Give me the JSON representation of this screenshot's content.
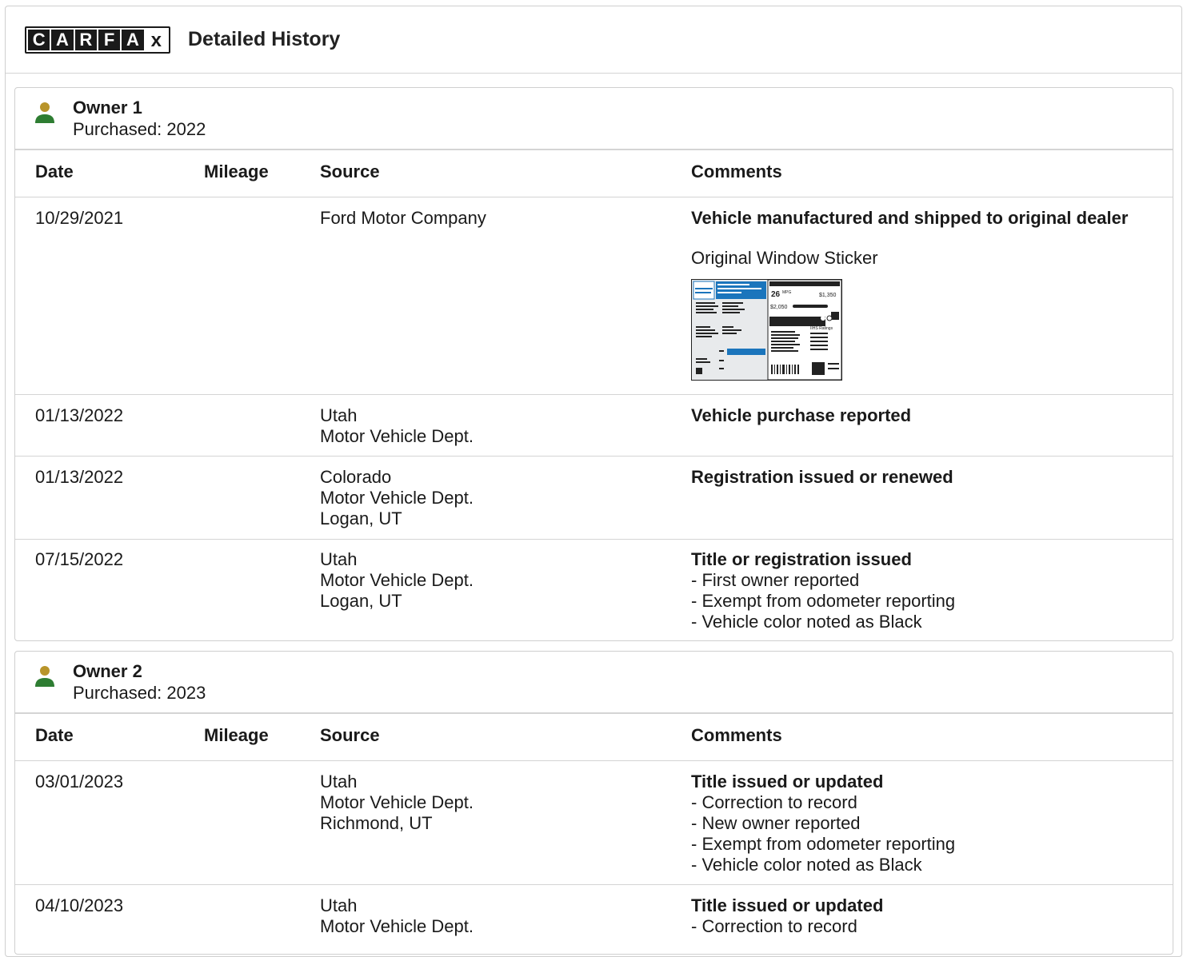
{
  "header": {
    "logo_letters": [
      "C",
      "A",
      "R",
      "F",
      "A",
      "x"
    ],
    "title": "Detailed History"
  },
  "columns": {
    "date": "Date",
    "mileage": "Mileage",
    "source": "Source",
    "comments": "Comments"
  },
  "owners": [
    {
      "name": "Owner 1",
      "purchased": "Purchased: 2022",
      "rows": [
        {
          "date": "10/29/2021",
          "mileage": "",
          "source": [
            "Ford Motor Company"
          ],
          "comment_title": "Vehicle manufactured and shipped to original dealer",
          "sticker_label": "Original Window Sticker",
          "sticker": {
            "mpg": "26",
            "mpg_unit": "MPG",
            "save": "$1,350",
            "fuel_cost": "$2,050",
            "ratings_label": "IIHS Ratings"
          },
          "details": []
        },
        {
          "date": "01/13/2022",
          "mileage": "",
          "source": [
            "Utah",
            "Motor Vehicle Dept."
          ],
          "comment_title": "Vehicle purchase reported",
          "details": []
        },
        {
          "date": "01/13/2022",
          "mileage": "",
          "source": [
            "Colorado",
            "Motor Vehicle Dept.",
            "Logan, UT"
          ],
          "comment_title": "Registration issued or renewed",
          "details": []
        },
        {
          "date": "07/15/2022",
          "mileage": "",
          "source": [
            "Utah",
            "Motor Vehicle Dept.",
            "Logan, UT"
          ],
          "comment_title": "Title or registration issued",
          "details": [
            "- First owner reported",
            "- Exempt from odometer reporting",
            "- Vehicle color noted as Black"
          ]
        }
      ]
    },
    {
      "name": "Owner 2",
      "purchased": "Purchased: 2023",
      "rows": [
        {
          "date": "03/01/2023",
          "mileage": "",
          "source": [
            "Utah",
            "Motor Vehicle Dept.",
            "Richmond, UT"
          ],
          "comment_title": "Title issued or updated",
          "details": [
            "- Correction to record",
            "- New owner reported",
            "- Exempt from odometer reporting",
            "- Vehicle color noted as Black"
          ]
        },
        {
          "date": "04/10/2023",
          "mileage": "",
          "source": [
            "Utah",
            "Motor Vehicle Dept."
          ],
          "comment_title": "Title issued or updated",
          "details": [
            "- Correction to record"
          ]
        }
      ]
    }
  ],
  "colors": {
    "person_head": "#b8942a",
    "person_body": "#2e7d32",
    "sticker_blue": "#1b75bc",
    "border": "#d4d4d4"
  }
}
